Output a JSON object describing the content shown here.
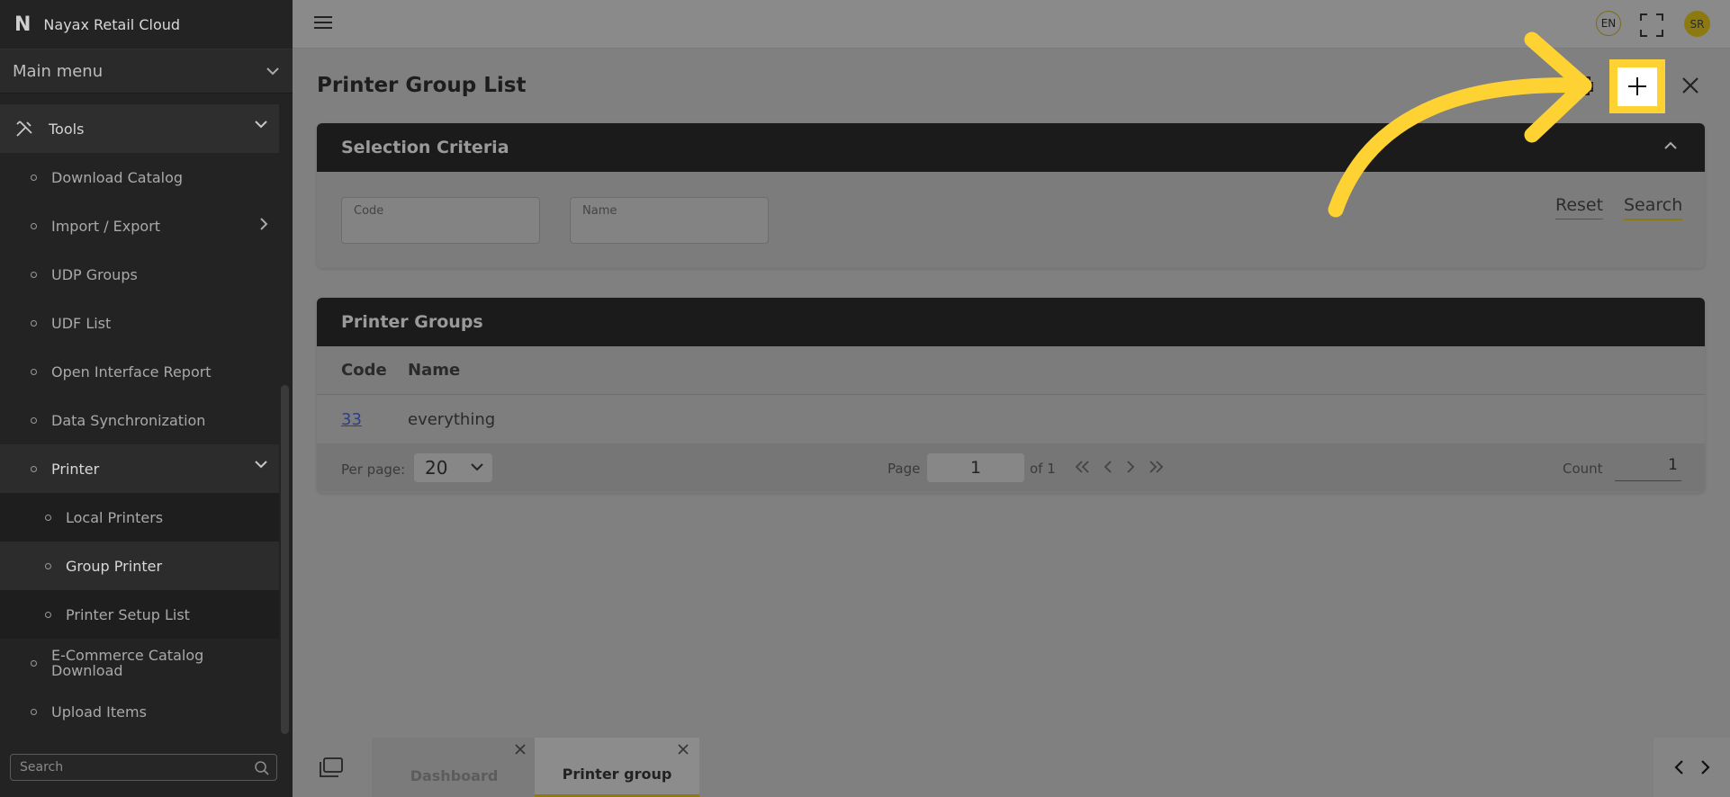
{
  "brand": {
    "logo": "N",
    "name": "Nayax Retail Cloud"
  },
  "sidebar": {
    "main_menu": "Main menu",
    "tools": "Tools",
    "items": [
      {
        "label": "Download Catalog"
      },
      {
        "label": "Import / Export"
      },
      {
        "label": "UDP Groups"
      },
      {
        "label": "UDF List"
      },
      {
        "label": "Open Interface Report"
      },
      {
        "label": "Data Synchronization"
      },
      {
        "label": "Printer"
      },
      {
        "label": "Local Printers"
      },
      {
        "label": "Group Printer"
      },
      {
        "label": "Printer Setup List"
      },
      {
        "label": "E-Commerce Catalog Download"
      },
      {
        "label": "Upload Items"
      }
    ],
    "search_placeholder": "Search"
  },
  "topbar": {
    "lang": "EN",
    "avatar": "SR"
  },
  "page": {
    "title": "Printer Group List"
  },
  "selection": {
    "title": "Selection Criteria",
    "code_label": "Code",
    "name_label": "Name",
    "reset": "Reset",
    "search": "Search"
  },
  "table": {
    "title": "Printer Groups",
    "headers": {
      "code": "Code",
      "name": "Name"
    },
    "rows": [
      {
        "code": "33",
        "name": "everything"
      }
    ],
    "pager": {
      "per_page_label": "Per page:",
      "per_page": "20",
      "page_label": "Page",
      "page": "1",
      "of": "of 1",
      "count_label": "Count",
      "count": "1"
    }
  },
  "tabs": [
    {
      "label": "Dashboard"
    },
    {
      "label": "Printer group"
    }
  ],
  "colors": {
    "accent": "#ffd233",
    "header": "#1b1b1b",
    "sidebar": "#232323"
  }
}
